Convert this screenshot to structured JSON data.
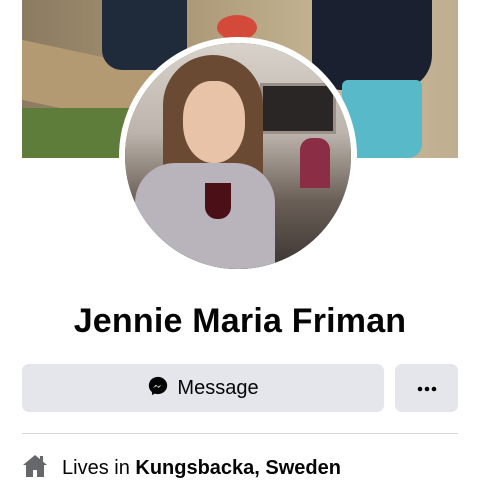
{
  "profile": {
    "name": "Jennie Maria Friman"
  },
  "actions": {
    "message_label": "Message",
    "message_icon": "messenger-icon",
    "more_icon": "more-options-icon"
  },
  "intro": {
    "lives_prefix": "Lives in",
    "location": "Kungsbacka, Sweden",
    "icon": "home-icon"
  },
  "colors": {
    "button_bg": "#e4e6eb",
    "text": "#050505",
    "divider": "#d6d8dc"
  }
}
